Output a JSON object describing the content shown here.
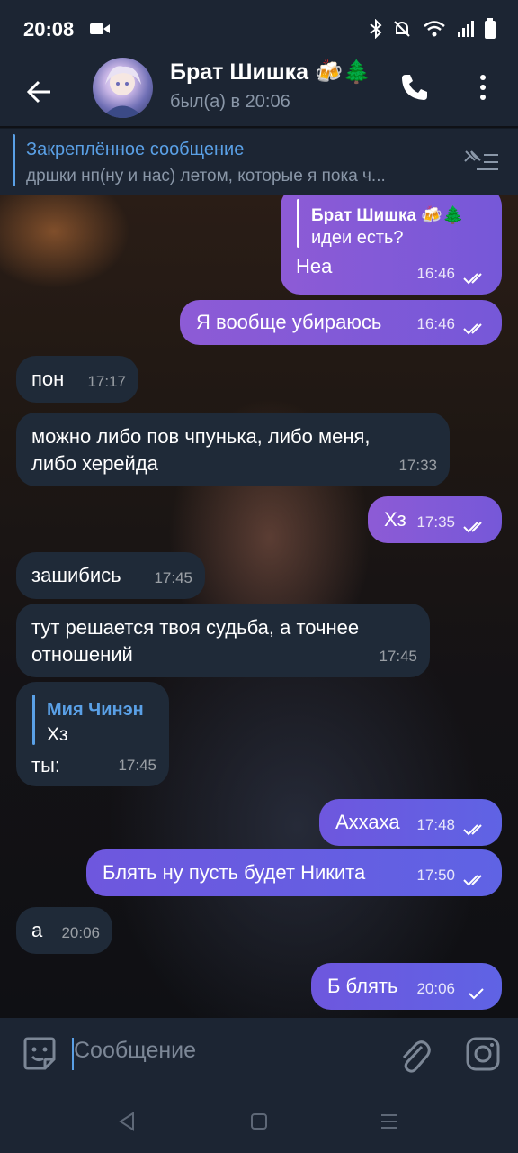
{
  "status_bar": {
    "time": "20:08"
  },
  "header": {
    "title": "Брат Шишка 🍻🌲",
    "status": "был(а) в 20:06"
  },
  "pinned": {
    "label": "Закреплённое сообщение",
    "text": "дршки нп(ну и нас) летом, которые я пока ч..."
  },
  "messages": [
    {
      "side": "out",
      "reply_author": "Брат Шишка 🍻🌲",
      "reply_text": "идеи есть?",
      "text": "Неа",
      "time": "16:46",
      "read": true
    },
    {
      "side": "out",
      "text": "Я вообще убираюсь",
      "time": "16:46",
      "read": true
    },
    {
      "side": "in",
      "text": "пон",
      "time": "17:17"
    },
    {
      "side": "in",
      "text_line1": "можно либо пов чпунька, либо меня,",
      "text_line2": "либо херейда",
      "time": "17:33"
    },
    {
      "side": "out",
      "text": "Хз",
      "time": "17:35",
      "read": true
    },
    {
      "side": "in",
      "text": "зашибись",
      "time": "17:45"
    },
    {
      "side": "in",
      "text_line1": "тут решается твоя судьба, а точнее",
      "text_line2": "отношений",
      "time": "17:45"
    },
    {
      "side": "in",
      "reply_author": "Мия Чинэн",
      "reply_text": "Хз",
      "text": "ты:",
      "time": "17:45"
    },
    {
      "side": "out",
      "text": "Аххаха",
      "time": "17:48",
      "read": true
    },
    {
      "side": "out",
      "text": "Блять ну пусть будет Никита",
      "time": "17:50",
      "read": true
    },
    {
      "side": "in",
      "text": "а",
      "time": "20:06"
    },
    {
      "side": "out",
      "text": "Б блять",
      "time": "20:06",
      "read": false
    }
  ],
  "input": {
    "placeholder": "Сообщение"
  },
  "icons": {
    "status": [
      "video-record-icon",
      "bluetooth-icon",
      "mute-icon",
      "wifi-icon",
      "signal-icon",
      "battery-icon"
    ],
    "header": [
      "back-arrow-icon",
      "phone-icon",
      "more-vert-icon"
    ],
    "input": [
      "sticker-icon",
      "attach-icon",
      "camera-icon"
    ],
    "nav": [
      "nav-back-icon",
      "nav-home-icon",
      "nav-recent-icon"
    ]
  },
  "colors": {
    "accent": "#5aa0e6",
    "outgoing": "#7d59d8",
    "incoming": "#1f2a38",
    "bar": "#1c2533"
  }
}
